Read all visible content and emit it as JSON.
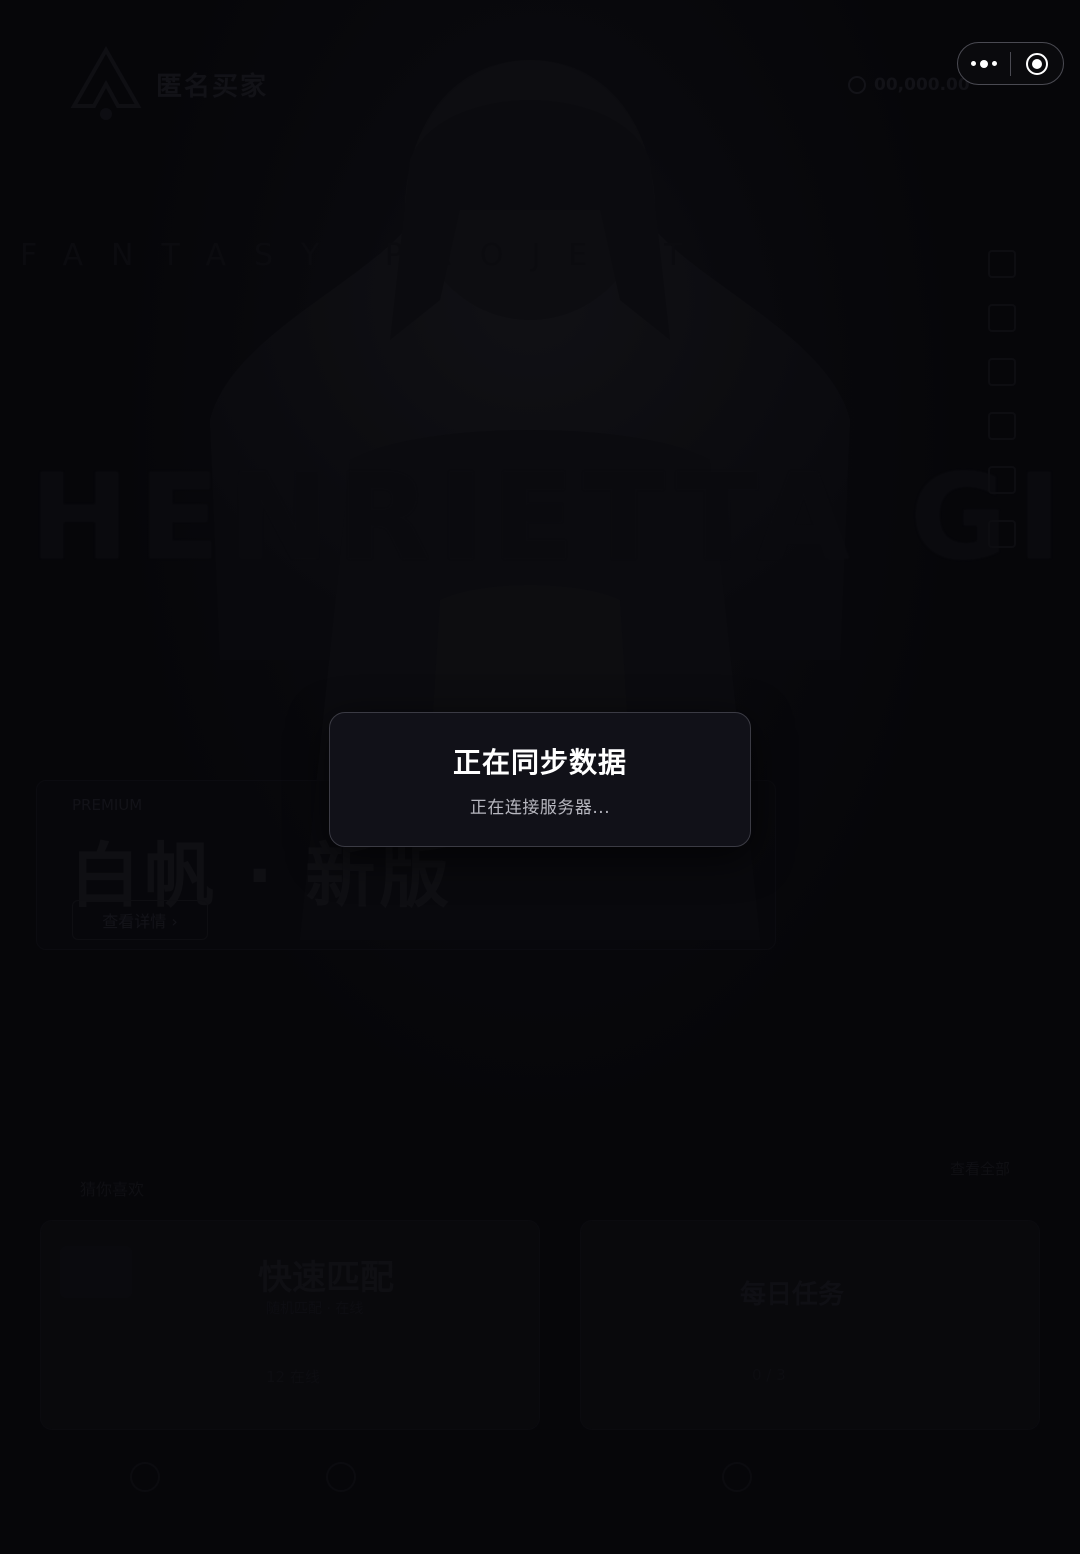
{
  "app": {
    "brand_name": "匿名买家",
    "coin_balance": "00,000.00"
  },
  "hero": {
    "wordmark": "HENRIETTA GIMMA",
    "subline": "FANTASY PROJECT",
    "tag": "PREMIUM",
    "title": "白帆 · 新版",
    "link_label": "查看详情 ›"
  },
  "sections": {
    "left_header": "猜你喜欢",
    "right_header": "查看全部"
  },
  "tiles": {
    "left_title": "快速匹配",
    "left_sub": "随机匹配 · 在线",
    "left_meta": "12 在线",
    "right_title": "每日任务",
    "right_meta": "0 / 3"
  },
  "capsule": {
    "more_icon": "more-dots-icon",
    "close_icon": "close-capsule-icon"
  },
  "dialog": {
    "title": "正在同步数据",
    "message": "正在连接服务器..."
  },
  "colors": {
    "background": "#0b0b10",
    "dialog_bg": "#111118",
    "dialog_border": "#3b3b44",
    "dialog_title": "#ffffff",
    "dialog_message": "#b7b7bf"
  }
}
